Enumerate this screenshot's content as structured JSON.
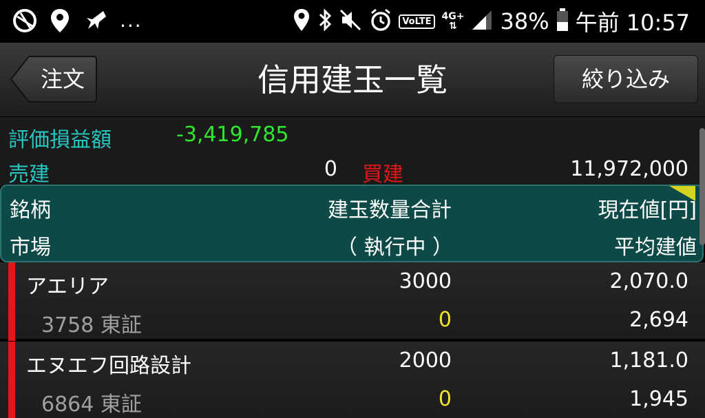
{
  "status_bar": {
    "battery": "38%",
    "time": "午前 10:57",
    "network": "4G+",
    "volte": "VoLTE",
    "more": "..."
  },
  "header": {
    "back_label": "注文",
    "title": "信用建玉一覧",
    "filter_label": "絞り込み"
  },
  "summary": {
    "pl_label": "評価損益額",
    "pl_value": "-3,419,785",
    "sell_label": "売建",
    "sell_value": "0",
    "buy_label": "買建",
    "buy_value": "11,972,000"
  },
  "columns": {
    "name": "銘柄",
    "qty_total": "建玉数量合計",
    "price": "現在値[円]",
    "market": "市場",
    "executing": "（ 執行中 ）",
    "avg_price": "平均建値"
  },
  "rows": [
    {
      "name": "アエリア",
      "code": "3758",
      "market": "東証",
      "qty": "3000",
      "executing": "0",
      "price": "2,070.0",
      "avg": "2,694"
    },
    {
      "name": "エヌエフ回路設計",
      "code": "6864",
      "market": "東証",
      "qty": "2000",
      "executing": "0",
      "price": "1,181.0",
      "avg": "1,945"
    }
  ],
  "colors": {
    "accent_teal": "#27c6c0",
    "loss_green": "#2ee82e",
    "buy_red": "#e01818",
    "executing_yellow": "#f3e22e"
  }
}
